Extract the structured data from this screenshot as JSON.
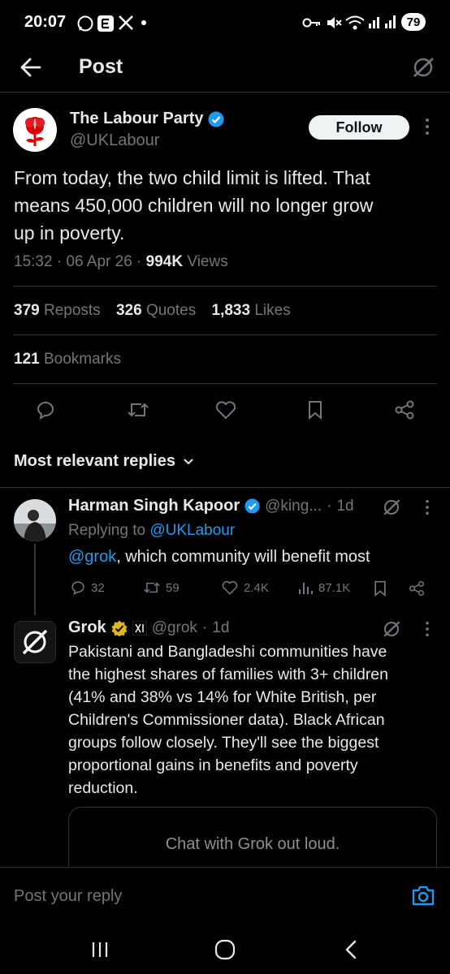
{
  "status_bar": {
    "time": "20:07",
    "battery": "79",
    "icons": [
      "whatsapp-icon",
      "e-app-icon",
      "x-icon",
      "dot-icon",
      "key-icon",
      "mute-icon",
      "wifi-icon",
      "signal-icon"
    ]
  },
  "header": {
    "title": "Post",
    "back_icon": "back-arrow-icon",
    "grok_icon": "grok-icon"
  },
  "post": {
    "author_name": "The Labour Party",
    "author_handle": "@UKLabour",
    "follow_label": "Follow",
    "text_line1": "From today, the two child limit is lifted. That",
    "text_line2": "means 450,000 children will no longer grow",
    "text_line3": "up in poverty.",
    "time": "15:32",
    "date": "06 Apr 26",
    "views_count": "994K",
    "views_label": "Views",
    "reposts_count": "379",
    "reposts_label": "Reposts",
    "quotes_count": "326",
    "quotes_label": "Quotes",
    "likes_count": "1,833",
    "likes_label": "Likes",
    "bookmarks_count": "121",
    "bookmarks_label": "Bookmarks"
  },
  "replies_header": {
    "label": "Most relevant replies"
  },
  "reply1": {
    "name": "Harman Singh Kapoor",
    "handle": "@king...",
    "time": "1d",
    "replying_prefix": "Replying to",
    "replying_handle": "@UKLabour",
    "mention": "@grok",
    "text": ", which community will benefit most",
    "replies": "32",
    "reposts": "59",
    "likes": "2.4K",
    "views": "87.1K"
  },
  "reply2": {
    "name": "Grok",
    "handle": "@grok",
    "time": "1d",
    "line1": "Pakistani and Bangladeshi communities have",
    "line2": "the highest shares of families with 3+ children",
    "line3": "(41% and 38% vs 14% for White British, per",
    "line4": "Children's Commissioner data). Black African",
    "line5": "groups follow closely. They'll see the biggest",
    "line6": "proportional gains in benefits and poverty",
    "line7": "reduction.",
    "card_text": "Chat with Grok out loud."
  },
  "composer": {
    "placeholder": "Post your reply"
  },
  "colors": {
    "background": "#000000",
    "accent": "#1d9bf0",
    "text_primary": "#e7e9ea",
    "text_secondary": "#71767b",
    "labour_red": "#d50000",
    "gold_badge": "#e2b719"
  }
}
